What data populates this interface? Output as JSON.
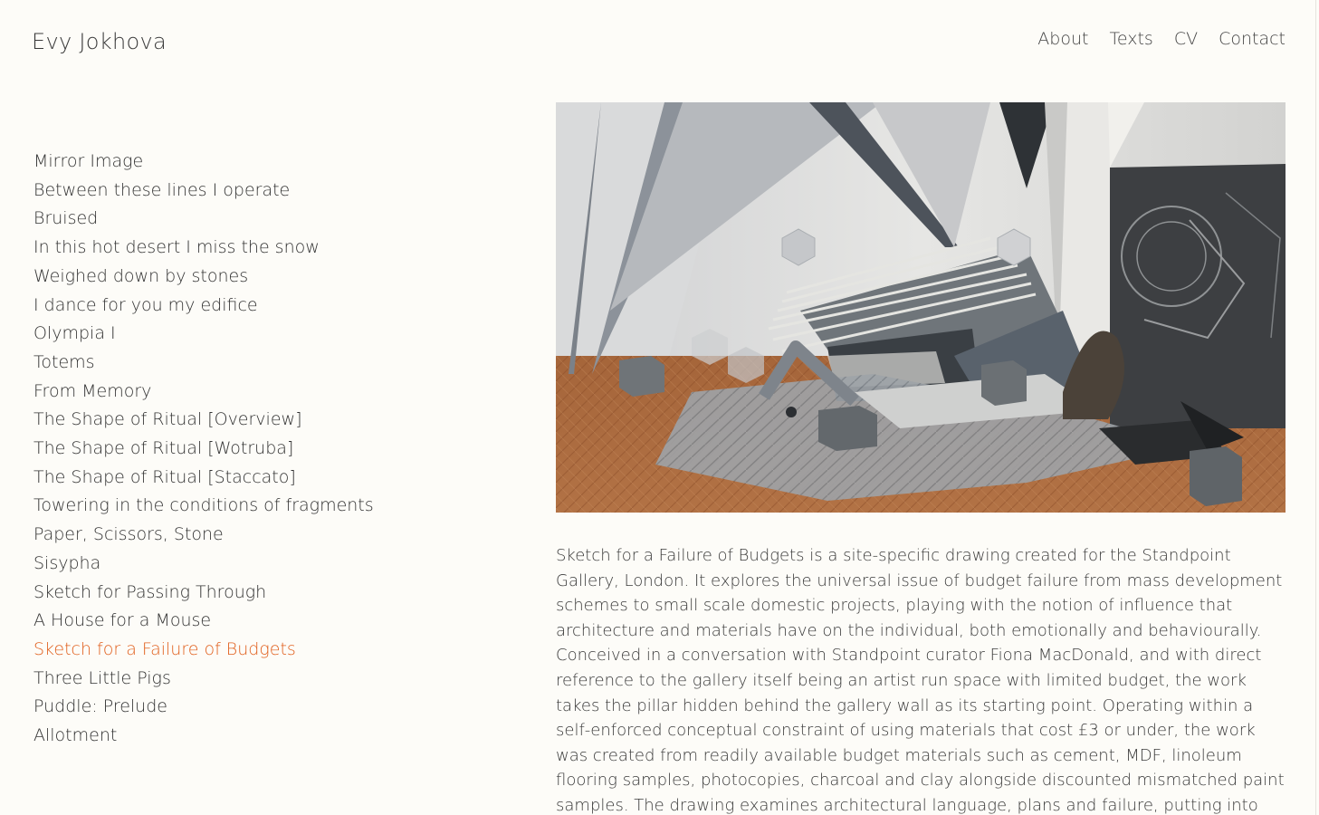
{
  "site": {
    "title": "Evy Jokhova"
  },
  "nav": {
    "items": [
      "About",
      "Texts",
      "CV",
      "Contact"
    ]
  },
  "works": {
    "items": [
      "Mirror Image",
      "Between these lines I operate",
      "Bruised",
      "In this hot desert I miss the snow",
      "Weighed down by stones",
      "I dance for you my edifice",
      "Olympia I",
      "Totems",
      "From Memory",
      "The Shape of Ritual [Overview]",
      "The Shape of Ritual [Wotruba]",
      "The Shape of Ritual [Staccato]",
      "Towering in the conditions of fragments",
      "Paper, Scissors, Stone",
      "Sisypha",
      "Sketch for Passing Through",
      "A House for a Mouse",
      "Sketch for a Failure of Budgets",
      "Three Little Pigs",
      "Puddle: Prelude",
      "Allotment"
    ],
    "active": "Sketch for a Failure of Budgets"
  },
  "colors": {
    "background": "#fdfcf8",
    "text": "#333333",
    "accent": "#e1611f"
  },
  "main": {
    "description": "Sketch for a Failure of Budgets is a site-specific drawing created for the Standpoint Gallery, London. It explores the universal issue of budget failure from mass development schemes to small scale domestic projects, playing with the notion of influence that architecture and materials have on the individual, both emotionally and behaviourally. Conceived in a conversation with Standpoint curator Fiona MacDonald, and with direct reference to the gallery itself being an artist run space with limited budget, the work takes the pillar hidden behind the gallery wall as its starting point. Operating within a self-enforced conceptual constraint of using materials that cost £3 or under, the work was created from readily available budget materials such as cement, MDF, linoleum flooring samples, photocopies, charcoal and clay alongside discounted mismatched paint samples. The drawing examines architectural language, plans and failure, putting into question scale, perception and form."
  }
}
